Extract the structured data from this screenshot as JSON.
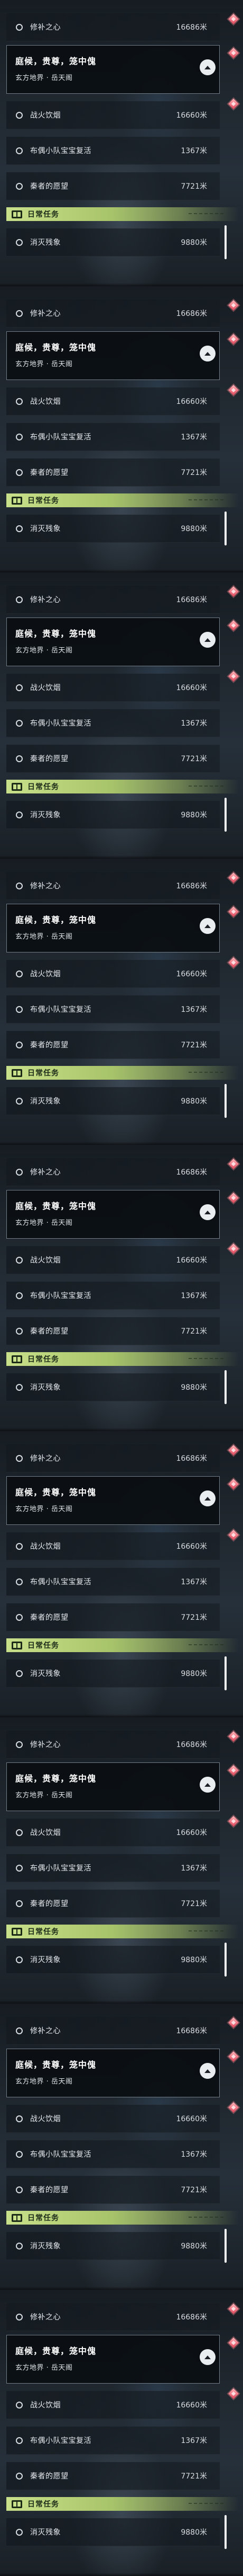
{
  "panels": [
    {
      "tracked_quest": {
        "name": "修补之心",
        "distance": "16686米"
      },
      "active_quest": {
        "title": "庭候，贵尊，笼中傀",
        "subtitle": "玄方地界 · 岳天阁"
      },
      "quests": [
        {
          "name": "战火饮烟",
          "distance": "16660米"
        },
        {
          "name": "布偶小队宝宝复活",
          "distance": "1367米"
        },
        {
          "name": "秦者的愿望",
          "distance": "7721米"
        }
      ],
      "daily_header": "日常任务",
      "daily_quest": {
        "name": "消灭残象",
        "distance": "9880米"
      }
    },
    {
      "tracked_quest": {
        "name": "修补之心",
        "distance": "16686米"
      },
      "active_quest": {
        "title": "庭候，贵尊，笼中傀",
        "subtitle": "玄方地界 · 岳天阁"
      },
      "quests": [
        {
          "name": "战火饮烟",
          "distance": "16660米"
        },
        {
          "name": "布偶小队宝宝复活",
          "distance": "1367米"
        },
        {
          "name": "秦者的愿望",
          "distance": "7721米"
        }
      ],
      "daily_header": "日常任务",
      "daily_quest": {
        "name": "消灭残象",
        "distance": "9880米"
      }
    },
    {
      "tracked_quest": {
        "name": "修补之心",
        "distance": "16686米"
      },
      "active_quest": {
        "title": "庭候，贵尊，笼中傀",
        "subtitle": "玄方地界 · 岳天阁"
      },
      "quests": [
        {
          "name": "战火饮烟",
          "distance": "16660米"
        },
        {
          "name": "布偶小队宝宝复活",
          "distance": "1367米"
        },
        {
          "name": "秦者的愿望",
          "distance": "7721米"
        }
      ],
      "daily_header": "日常任务",
      "daily_quest": {
        "name": "消灭残象",
        "distance": "9880米"
      }
    },
    {
      "tracked_quest": {
        "name": "修补之心",
        "distance": "16686米"
      },
      "active_quest": {
        "title": "庭候，贵尊，笼中傀",
        "subtitle": "玄方地界 · 岳天阁"
      },
      "quests": [
        {
          "name": "战火饮烟",
          "distance": "16660米"
        },
        {
          "name": "布偶小队宝宝复活",
          "distance": "1367米"
        },
        {
          "name": "秦者的愿望",
          "distance": "7721米"
        }
      ],
      "daily_header": "日常任务",
      "daily_quest": {
        "name": "消灭残象",
        "distance": "9880米"
      }
    },
    {
      "tracked_quest": {
        "name": "修补之心",
        "distance": "16686米"
      },
      "active_quest": {
        "title": "庭候，贵尊，笼中傀",
        "subtitle": "玄方地界 · 岳天阁"
      },
      "quests": [
        {
          "name": "战火饮烟",
          "distance": "16660米"
        },
        {
          "name": "布偶小队宝宝复活",
          "distance": "1367米"
        },
        {
          "name": "秦者的愿望",
          "distance": "7721米"
        }
      ],
      "daily_header": "日常任务",
      "daily_quest": {
        "name": "消灭残象",
        "distance": "9880米"
      }
    },
    {
      "tracked_quest": {
        "name": "修补之心",
        "distance": "16686米"
      },
      "active_quest": {
        "title": "庭候，贵尊，笼中傀",
        "subtitle": "玄方地界 · 岳天阁"
      },
      "quests": [
        {
          "name": "战火饮烟",
          "distance": "16660米"
        },
        {
          "name": "布偶小队宝宝复活",
          "distance": "1367米"
        },
        {
          "name": "秦者的愿望",
          "distance": "7721米"
        }
      ],
      "daily_header": "日常任务",
      "daily_quest": {
        "name": "消灭残象",
        "distance": "9880米"
      }
    },
    {
      "tracked_quest": {
        "name": "修补之心",
        "distance": "16686米"
      },
      "active_quest": {
        "title": "庭候，贵尊，笼中傀",
        "subtitle": "玄方地界 · 岳天阁"
      },
      "quests": [
        {
          "name": "战火饮烟",
          "distance": "16660米"
        },
        {
          "name": "布偶小队宝宝复活",
          "distance": "1367米"
        },
        {
          "name": "秦者的愿望",
          "distance": "7721米"
        }
      ],
      "daily_header": "日常任务",
      "daily_quest": {
        "name": "消灭残象",
        "distance": "9880米"
      }
    },
    {
      "tracked_quest": {
        "name": "修补之心",
        "distance": "16686米"
      },
      "active_quest": {
        "title": "庭候，贵尊，笼中傀",
        "subtitle": "玄方地界 · 岳天阁"
      },
      "quests": [
        {
          "name": "战火饮烟",
          "distance": "16660米"
        },
        {
          "name": "布偶小队宝宝复活",
          "distance": "1367米"
        },
        {
          "name": "秦者的愿望",
          "distance": "7721米"
        }
      ],
      "daily_header": "日常任务",
      "daily_quest": {
        "name": "消灭残象",
        "distance": "9880米"
      }
    },
    {
      "tracked_quest": {
        "name": "修补之心",
        "distance": "16686米"
      },
      "active_quest": {
        "title": "庭候，贵尊，笼中傀",
        "subtitle": "玄方地界 · 岳天阁"
      },
      "quests": [
        {
          "name": "战火饮烟",
          "distance": "16660米"
        },
        {
          "name": "布偶小队宝宝复活",
          "distance": "1367米"
        },
        {
          "name": "秦者的愿望",
          "distance": "7721米"
        }
      ],
      "daily_header": "日常任务",
      "daily_quest": {
        "name": "消灭残象",
        "distance": "9880米"
      }
    }
  ],
  "icons": {
    "row_marker": "circle-outline-icon",
    "waypoint": "diamond-waypoint-icon",
    "collapse": "chevron-up-icon",
    "daily": "book-icon"
  },
  "colors": {
    "daily_header_bg": "#c8e08a",
    "waypoint": "#e0465a",
    "active_border": "#c8d7e6"
  }
}
